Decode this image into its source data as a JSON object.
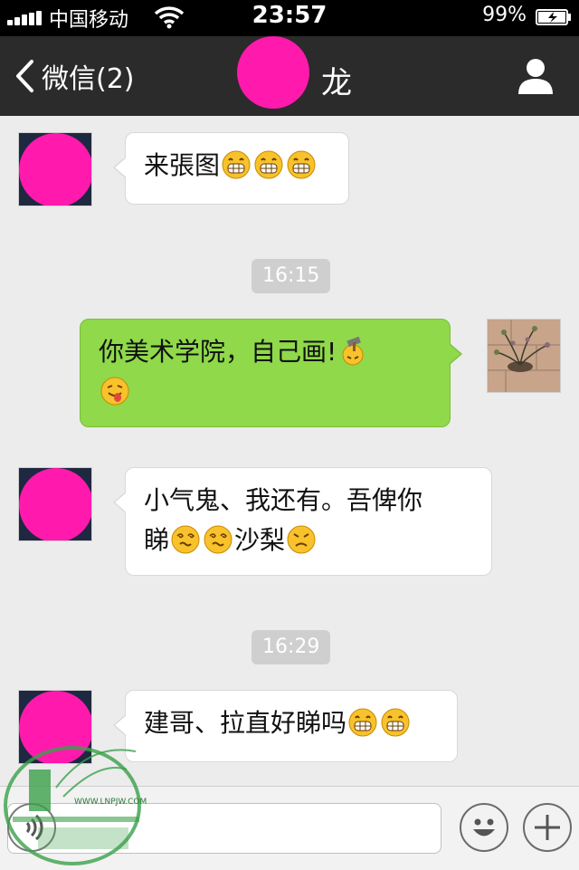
{
  "status_bar": {
    "carrier": "中国移动",
    "time": "23:57",
    "battery_percent": "99%"
  },
  "nav_bar": {
    "back_label": "微信(2)",
    "title": "龙"
  },
  "messages": [
    {
      "side": "left",
      "text": "来張图"
    },
    {
      "timestamp": "16:15"
    },
    {
      "side": "right",
      "text": "你美术学院，自己画!"
    },
    {
      "side": "left",
      "text_line1": "小气鬼、我还有。吾俾你",
      "text_line2a": "睇",
      "text_line2b": "沙梨"
    },
    {
      "timestamp": "16:29"
    },
    {
      "side": "left",
      "text": "建哥、拉直好睇吗"
    }
  ],
  "watermark": {
    "url": "WWW.LNPJW.COM"
  },
  "colors": {
    "nav_bg": "#2b2b2b",
    "chat_bg": "#ececec",
    "outgoing_bubble": "#8fd94a",
    "incoming_bubble": "#ffffff",
    "redaction": "#ff1aad"
  }
}
